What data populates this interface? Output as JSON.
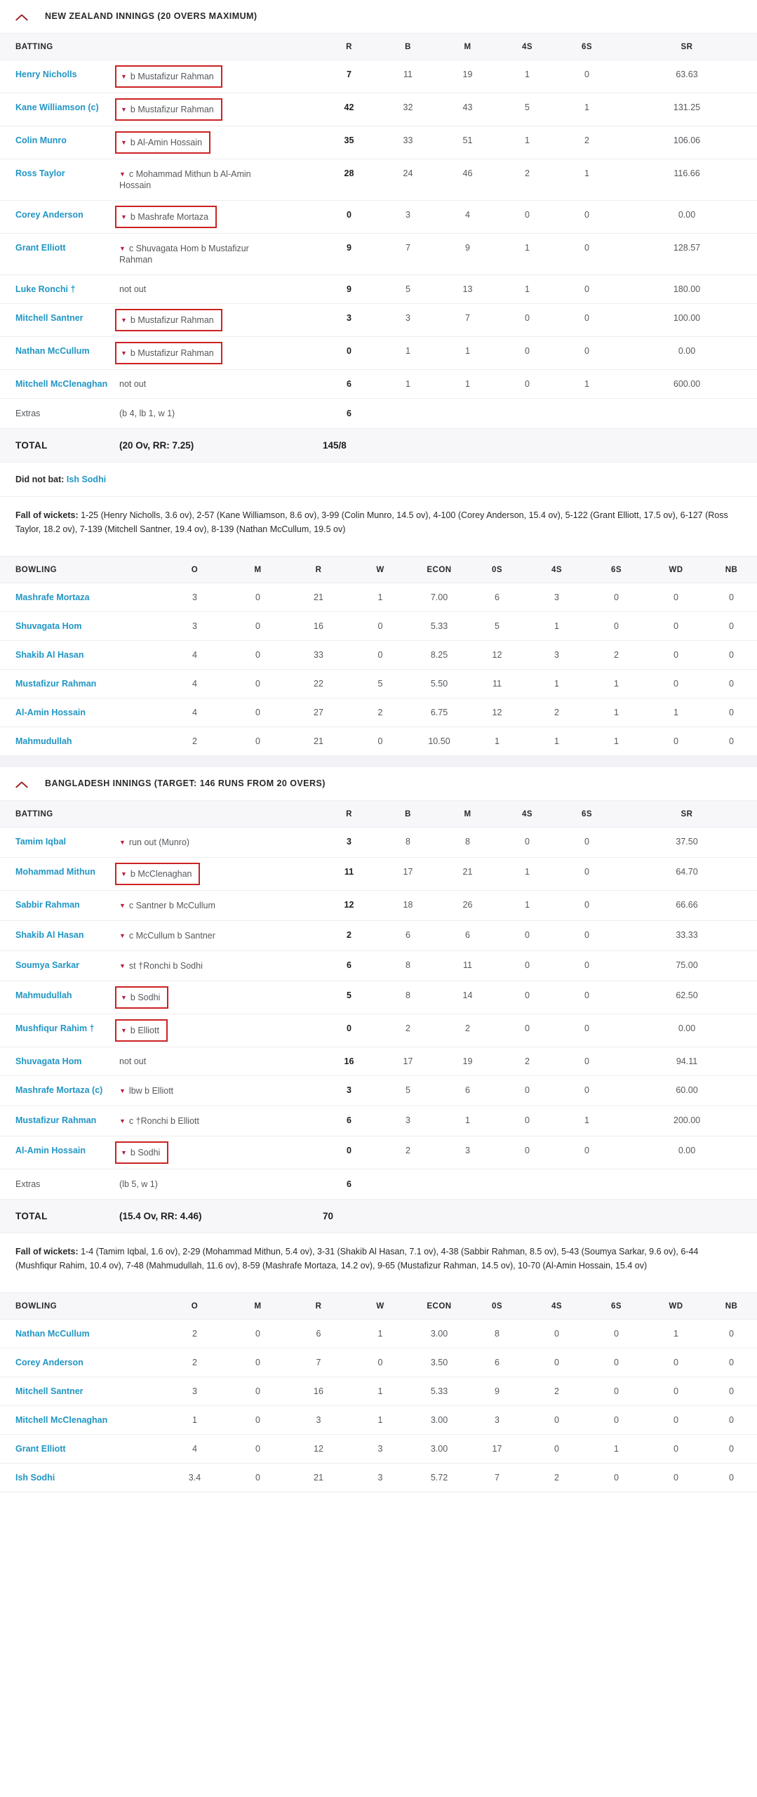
{
  "accent": {
    "link": "#2196c4",
    "highlight_box": "#cc2222",
    "caret": "#b5213a",
    "header_bg": "#f7f7fa"
  },
  "icons": {
    "collapse": "chevron-up-icon",
    "dismissal_caret": "caret-down-icon"
  },
  "innings": [
    {
      "id": "new-zealand",
      "title": "NEW ZEALAND INNINGS (20 OVERS MAXIMUM)",
      "batting_headers": [
        "BATTING",
        "",
        "R",
        "B",
        "M",
        "4s",
        "6s",
        "SR"
      ],
      "batsmen": [
        {
          "name": "Henry Nicholls",
          "dismissal": "b Mustafizur Rahman",
          "boxed": true,
          "caret": true,
          "R": "7",
          "B": "11",
          "M": "19",
          "4s": "1",
          "6s": "0",
          "SR": "63.63"
        },
        {
          "name": "Kane Williamson (c)",
          "dismissal": "b Mustafizur Rahman",
          "boxed": true,
          "caret": true,
          "R": "42",
          "B": "32",
          "M": "43",
          "4s": "5",
          "6s": "1",
          "SR": "131.25"
        },
        {
          "name": "Colin Munro",
          "dismissal": "b Al-Amin Hossain",
          "boxed": true,
          "caret": true,
          "R": "35",
          "B": "33",
          "M": "51",
          "4s": "1",
          "6s": "2",
          "SR": "106.06"
        },
        {
          "name": "Ross Taylor",
          "dismissal": "c Mohammad Mithun b Al-Amin Hossain",
          "boxed": false,
          "caret": true,
          "R": "28",
          "B": "24",
          "M": "46",
          "4s": "2",
          "6s": "1",
          "SR": "116.66"
        },
        {
          "name": "Corey Anderson",
          "dismissal": "b Mashrafe Mortaza",
          "boxed": true,
          "caret": true,
          "R": "0",
          "B": "3",
          "M": "4",
          "4s": "0",
          "6s": "0",
          "SR": "0.00"
        },
        {
          "name": "Grant Elliott",
          "dismissal": "c Shuvagata Hom b Mustafizur Rahman",
          "boxed": false,
          "caret": true,
          "R": "9",
          "B": "7",
          "M": "9",
          "4s": "1",
          "6s": "0",
          "SR": "128.57"
        },
        {
          "name": "Luke Ronchi †",
          "dismissal": "not out",
          "boxed": false,
          "caret": false,
          "R": "9",
          "B": "5",
          "M": "13",
          "4s": "1",
          "6s": "0",
          "SR": "180.00"
        },
        {
          "name": "Mitchell Santner",
          "dismissal": "b Mustafizur Rahman",
          "boxed": true,
          "caret": true,
          "R": "3",
          "B": "3",
          "M": "7",
          "4s": "0",
          "6s": "0",
          "SR": "100.00"
        },
        {
          "name": "Nathan McCullum",
          "dismissal": "b Mustafizur Rahman",
          "boxed": true,
          "caret": true,
          "R": "0",
          "B": "1",
          "M": "1",
          "4s": "0",
          "6s": "0",
          "SR": "0.00"
        },
        {
          "name": "Mitchell McClenaghan",
          "dismissal": "not out",
          "boxed": false,
          "caret": false,
          "R": "6",
          "B": "1",
          "M": "1",
          "4s": "0",
          "6s": "1",
          "SR": "600.00"
        }
      ],
      "extras": {
        "label": "Extras",
        "detail": "(b 4, lb 1, w 1)",
        "value": "6"
      },
      "total": {
        "label": "TOTAL",
        "detail": "(20 Ov, RR: 7.25)",
        "value": "145/8"
      },
      "did_not_bat": {
        "label": "Did not bat:",
        "players": "Ish Sodhi"
      },
      "fall_of_wickets": {
        "label": "Fall of wickets:",
        "text": "1-25 (Henry Nicholls, 3.6 ov), 2-57 (Kane Williamson, 8.6 ov), 3-99 (Colin Munro, 14.5 ov), 4-100 (Corey Anderson, 15.4 ov), 5-122 (Grant Elliott, 17.5 ov), 6-127 (Ross Taylor, 18.2 ov), 7-139 (Mitchell Santner, 19.4 ov), 8-139 (Nathan McCullum, 19.5 ov)"
      },
      "bowling_headers": [
        "BOWLING",
        "O",
        "M",
        "R",
        "W",
        "ECON",
        "0s",
        "4s",
        "6s",
        "WD",
        "NB"
      ],
      "bowlers": [
        {
          "name": "Mashrafe Mortaza",
          "O": "3",
          "M": "0",
          "R": "21",
          "W": "1",
          "ECON": "7.00",
          "0s": "6",
          "4s": "3",
          "6s": "0",
          "WD": "0",
          "NB": "0"
        },
        {
          "name": "Shuvagata Hom",
          "O": "3",
          "M": "0",
          "R": "16",
          "W": "0",
          "ECON": "5.33",
          "0s": "5",
          "4s": "1",
          "6s": "0",
          "WD": "0",
          "NB": "0"
        },
        {
          "name": "Shakib Al Hasan",
          "O": "4",
          "M": "0",
          "R": "33",
          "W": "0",
          "ECON": "8.25",
          "0s": "12",
          "4s": "3",
          "6s": "2",
          "WD": "0",
          "NB": "0"
        },
        {
          "name": "Mustafizur Rahman",
          "O": "4",
          "M": "0",
          "R": "22",
          "W": "5",
          "ECON": "5.50",
          "0s": "11",
          "4s": "1",
          "6s": "1",
          "WD": "0",
          "NB": "0"
        },
        {
          "name": "Al-Amin Hossain",
          "O": "4",
          "M": "0",
          "R": "27",
          "W": "2",
          "ECON": "6.75",
          "0s": "12",
          "4s": "2",
          "6s": "1",
          "WD": "1",
          "NB": "0"
        },
        {
          "name": "Mahmudullah",
          "O": "2",
          "M": "0",
          "R": "21",
          "W": "0",
          "ECON": "10.50",
          "0s": "1",
          "4s": "1",
          "6s": "1",
          "WD": "0",
          "NB": "0"
        }
      ]
    },
    {
      "id": "bangladesh",
      "title": "BANGLADESH INNINGS (TARGET: 146 RUNS FROM 20 OVERS)",
      "batting_headers": [
        "BATTING",
        "",
        "R",
        "B",
        "M",
        "4s",
        "6s",
        "SR"
      ],
      "batsmen": [
        {
          "name": "Tamim Iqbal",
          "dismissal": "run out (Munro)",
          "boxed": false,
          "caret": true,
          "R": "3",
          "B": "8",
          "M": "8",
          "4s": "0",
          "6s": "0",
          "SR": "37.50"
        },
        {
          "name": "Mohammad Mithun",
          "dismissal": "b McClenaghan",
          "boxed": true,
          "caret": true,
          "R": "11",
          "B": "17",
          "M": "21",
          "4s": "1",
          "6s": "0",
          "SR": "64.70"
        },
        {
          "name": "Sabbir Rahman",
          "dismissal": "c Santner b McCullum",
          "boxed": false,
          "caret": true,
          "R": "12",
          "B": "18",
          "M": "26",
          "4s": "1",
          "6s": "0",
          "SR": "66.66"
        },
        {
          "name": "Shakib Al Hasan",
          "dismissal": "c McCullum b Santner",
          "boxed": false,
          "caret": true,
          "R": "2",
          "B": "6",
          "M": "6",
          "4s": "0",
          "6s": "0",
          "SR": "33.33"
        },
        {
          "name": "Soumya Sarkar",
          "dismissal": "st †Ronchi b Sodhi",
          "boxed": false,
          "caret": true,
          "R": "6",
          "B": "8",
          "M": "11",
          "4s": "0",
          "6s": "0",
          "SR": "75.00"
        },
        {
          "name": "Mahmudullah",
          "dismissal": "b Sodhi",
          "boxed": true,
          "caret": true,
          "R": "5",
          "B": "8",
          "M": "14",
          "4s": "0",
          "6s": "0",
          "SR": "62.50"
        },
        {
          "name": "Mushfiqur Rahim †",
          "dismissal": "b Elliott",
          "boxed": true,
          "caret": true,
          "R": "0",
          "B": "2",
          "M": "2",
          "4s": "0",
          "6s": "0",
          "SR": "0.00"
        },
        {
          "name": "Shuvagata Hom",
          "dismissal": "not out",
          "boxed": false,
          "caret": false,
          "R": "16",
          "B": "17",
          "M": "19",
          "4s": "2",
          "6s": "0",
          "SR": "94.11"
        },
        {
          "name": "Mashrafe Mortaza (c)",
          "dismissal": "lbw b Elliott",
          "boxed": false,
          "caret": true,
          "R": "3",
          "B": "5",
          "M": "6",
          "4s": "0",
          "6s": "0",
          "SR": "60.00"
        },
        {
          "name": "Mustafizur Rahman",
          "dismissal": "c †Ronchi b Elliott",
          "boxed": false,
          "caret": true,
          "R": "6",
          "B": "3",
          "M": "1",
          "4s": "0",
          "6s": "1",
          "SR": "200.00"
        },
        {
          "name": "Al-Amin Hossain",
          "dismissal": "b Sodhi",
          "boxed": true,
          "caret": true,
          "R": "0",
          "B": "2",
          "M": "3",
          "4s": "0",
          "6s": "0",
          "SR": "0.00"
        }
      ],
      "extras": {
        "label": "Extras",
        "detail": "(lb 5, w 1)",
        "value": "6"
      },
      "total": {
        "label": "TOTAL",
        "detail": "(15.4 Ov, RR: 4.46)",
        "value": "70"
      },
      "did_not_bat": null,
      "fall_of_wickets": {
        "label": "Fall of wickets:",
        "text": "1-4 (Tamim Iqbal, 1.6 ov), 2-29 (Mohammad Mithun, 5.4 ov), 3-31 (Shakib Al Hasan, 7.1 ov), 4-38 (Sabbir Rahman, 8.5 ov), 5-43 (Soumya Sarkar, 9.6 ov), 6-44 (Mushfiqur Rahim, 10.4 ov), 7-48 (Mahmudullah, 11.6 ov), 8-59 (Mashrafe Mortaza, 14.2 ov), 9-65 (Mustafizur Rahman, 14.5 ov), 10-70 (Al-Amin Hossain, 15.4 ov)"
      },
      "bowling_headers": [
        "BOWLING",
        "O",
        "M",
        "R",
        "W",
        "ECON",
        "0s",
        "4s",
        "6s",
        "WD",
        "NB"
      ],
      "bowlers": [
        {
          "name": "Nathan McCullum",
          "O": "2",
          "M": "0",
          "R": "6",
          "W": "1",
          "ECON": "3.00",
          "0s": "8",
          "4s": "0",
          "6s": "0",
          "WD": "1",
          "NB": "0"
        },
        {
          "name": "Corey Anderson",
          "O": "2",
          "M": "0",
          "R": "7",
          "W": "0",
          "ECON": "3.50",
          "0s": "6",
          "4s": "0",
          "6s": "0",
          "WD": "0",
          "NB": "0"
        },
        {
          "name": "Mitchell Santner",
          "O": "3",
          "M": "0",
          "R": "16",
          "W": "1",
          "ECON": "5.33",
          "0s": "9",
          "4s": "2",
          "6s": "0",
          "WD": "0",
          "NB": "0"
        },
        {
          "name": "Mitchell McClenaghan",
          "O": "1",
          "M": "0",
          "R": "3",
          "W": "1",
          "ECON": "3.00",
          "0s": "3",
          "4s": "0",
          "6s": "0",
          "WD": "0",
          "NB": "0"
        },
        {
          "name": "Grant Elliott",
          "O": "4",
          "M": "0",
          "R": "12",
          "W": "3",
          "ECON": "3.00",
          "0s": "17",
          "4s": "0",
          "6s": "1",
          "WD": "0",
          "NB": "0"
        },
        {
          "name": "Ish Sodhi",
          "O": "3.4",
          "M": "0",
          "R": "21",
          "W": "3",
          "ECON": "5.72",
          "0s": "7",
          "4s": "2",
          "6s": "0",
          "WD": "0",
          "NB": "0"
        }
      ]
    }
  ]
}
